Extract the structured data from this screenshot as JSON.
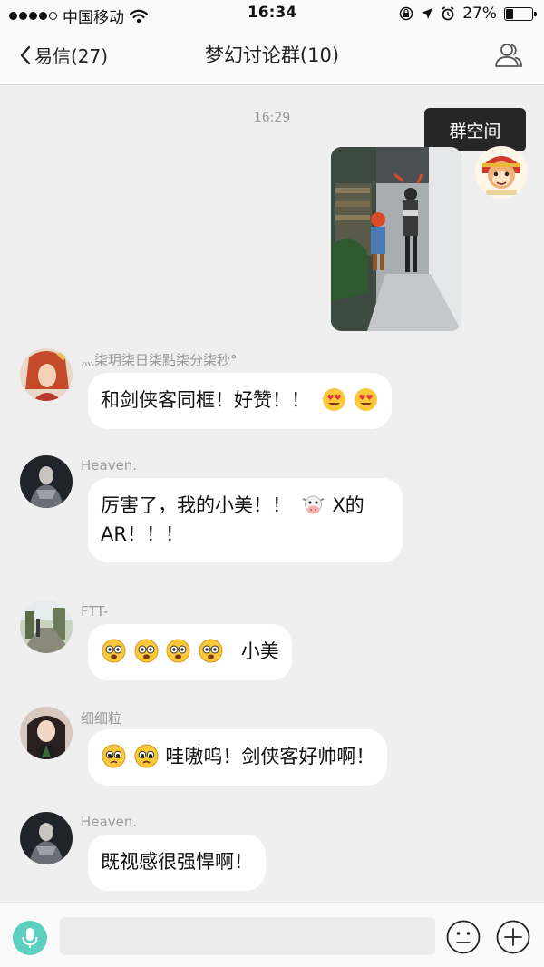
{
  "status_bar": {
    "carrier": "中国移动",
    "time": "16:34",
    "battery": "27%",
    "battery_level": 0.27
  },
  "nav": {
    "back_label": "易信(27)",
    "title": "梦幻讨论群(10)"
  },
  "chat": {
    "timestamp": "16:29",
    "group_space_label": "群空间",
    "messages": [
      {
        "sender": "灬柒玥柒日柒點柒分柒秒°",
        "text_before": "和剑侠客同框！好赞！！",
        "emojis": [
          "heart-eyes",
          "heart-eyes"
        ],
        "text_after": ""
      },
      {
        "sender": "Heaven.",
        "line1_before": "厉害了，我的小美！！",
        "line1_emoji": "cow-face",
        "line1_after": "X的",
        "line2": "AR！！！"
      },
      {
        "sender": "FTT-",
        "emojis": [
          "flushed",
          "flushed",
          "flushed",
          "flushed"
        ],
        "text_after": "小美"
      },
      {
        "sender": "细细粒",
        "emojis": [
          "pleading",
          "pleading"
        ],
        "text_after": "哇嗷呜！剑侠客好帅啊！"
      },
      {
        "sender": "Heaven.",
        "text": "既视感很强悍啊！"
      }
    ]
  },
  "colors": {
    "mic_button": "#5ccfc0",
    "chat_background": "#efefef",
    "tooltip": "#262626"
  }
}
